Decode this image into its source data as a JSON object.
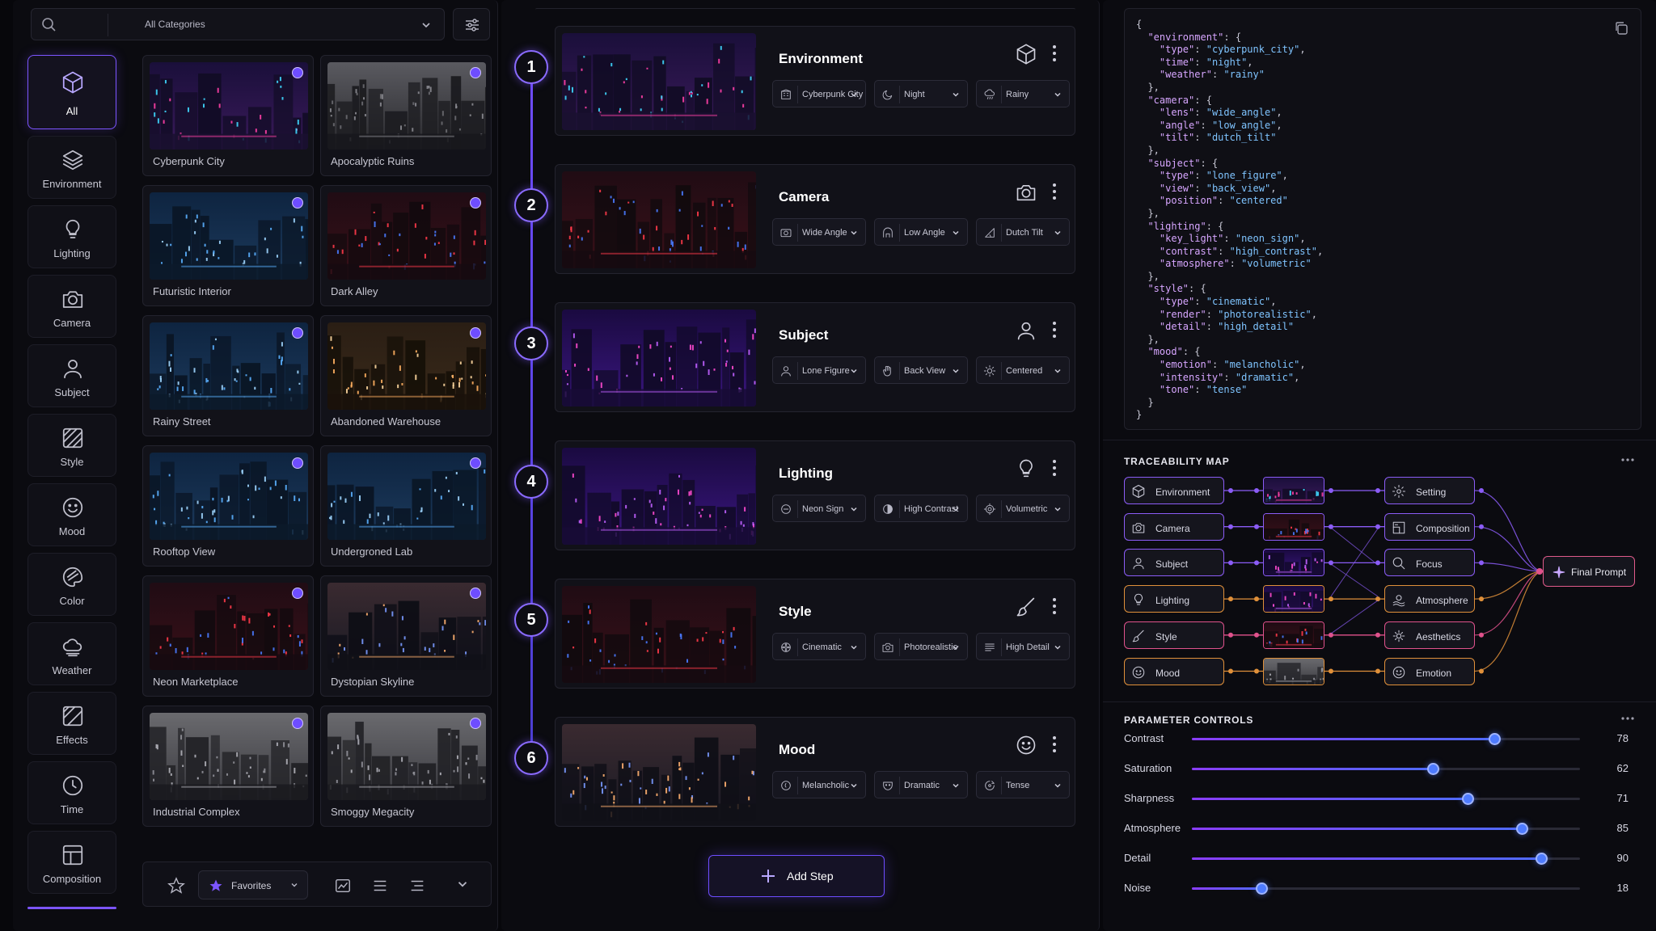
{
  "left": {
    "search_icon": "search-icon",
    "category_select": "All Categories",
    "categories": [
      {
        "label": "All",
        "icon": "cube-icon"
      },
      {
        "label": "Environment",
        "icon": "layers-icon"
      },
      {
        "label": "Lighting",
        "icon": "lightbulb-icon"
      },
      {
        "label": "Camera",
        "icon": "camera-icon"
      },
      {
        "label": "Subject",
        "icon": "person-icon"
      },
      {
        "label": "Style",
        "icon": "hatch-icon"
      },
      {
        "label": "Mood",
        "icon": "smiley-icon"
      },
      {
        "label": "Color",
        "icon": "palette-icon"
      },
      {
        "label": "Weather",
        "icon": "cloud-icon"
      },
      {
        "label": "Effects",
        "icon": "effects-icon"
      },
      {
        "label": "Time",
        "icon": "clock-icon"
      },
      {
        "label": "Composition",
        "icon": "layout-icon"
      }
    ],
    "presets": [
      "Cyberpunk City",
      "Apocalyptic Ruins",
      "Futuristic Interior",
      "Dark Alley",
      "Rainy Street",
      "Abandoned Warehouse",
      "Rooftop View",
      "Undergroned Lab",
      "Neon Marketplace",
      "Dystopian Skyline",
      "Industrial Complex",
      "Smoggy Megacity"
    ],
    "favorites_label": "Favorites"
  },
  "steps": [
    {
      "num": "1",
      "title": "Environment",
      "icon": "cube-icon",
      "pills": [
        "Cyberpunk City",
        "Night",
        "Rainy"
      ]
    },
    {
      "num": "2",
      "title": "Camera",
      "icon": "camera-icon",
      "pills": [
        "Wide Angle",
        "Low Angle",
        "Dutch Tilt"
      ]
    },
    {
      "num": "3",
      "title": "Subject",
      "icon": "person-icon",
      "pills": [
        "Lone Figure",
        "Back View",
        "Centered"
      ]
    },
    {
      "num": "4",
      "title": "Lighting",
      "icon": "lightbulb-icon",
      "pills": [
        "Neon Sign",
        "High Contrast",
        "Volumetric"
      ]
    },
    {
      "num": "5",
      "title": "Style",
      "icon": "brush-icon",
      "pills": [
        "Cinematic",
        "Photorealistic",
        "High Detail"
      ]
    },
    {
      "num": "6",
      "title": "Mood",
      "icon": "smiley-icon",
      "pills": [
        "Melancholic",
        "Dramatic",
        "Tense"
      ]
    }
  ],
  "add_step_label": "Add Step",
  "json_preview": [
    "{",
    "  \"environment\": {",
    "    \"type\": \"cyberpunk_city\",",
    "    \"time\": \"night\",",
    "    \"weather\": \"rainy\"",
    "  },",
    "  \"camera\": {",
    "    \"lens\": \"wide_angle\",",
    "    \"angle\": \"low_angle\",",
    "    \"tilt\": \"dutch_tilt\"",
    "  },",
    "  \"subject\": {",
    "    \"type\": \"lone_figure\",",
    "    \"view\": \"back_view\",",
    "    \"position\": \"centered\"",
    "  },",
    "  \"lighting\": {",
    "    \"key_light\": \"neon_sign\",",
    "    \"contrast\": \"high_contrast\",",
    "    \"atmosphere\": \"volumetric\"",
    "  },",
    "  \"style\": {",
    "    \"type\": \"cinematic\",",
    "    \"render\": \"photorealistic\",",
    "    \"detail\": \"high_detail\"",
    "  },",
    "  \"mood\": {",
    "    \"emotion\": \"melancholic\",",
    "    \"intensity\": \"dramatic\",",
    "    \"tone\": \"tense\"",
    "  }",
    "}"
  ],
  "traceability": {
    "title": "TRACEABILITY MAP",
    "sources": [
      "Environment",
      "Camera",
      "Subject",
      "Lighting",
      "Style",
      "Mood"
    ],
    "targets": [
      "Setting",
      "Composition",
      "Focus",
      "Atmosphere",
      "Aesthetics",
      "Emotion"
    ],
    "final": "Final Prompt",
    "colors": {
      "purple": "#8b5cf6",
      "pink": "#e0528c",
      "orange": "#e0903a"
    }
  },
  "parameters": {
    "title": "PARAMETER CONTROLS",
    "items": [
      {
        "label": "Contrast",
        "value": 78
      },
      {
        "label": "Saturation",
        "value": 62
      },
      {
        "label": "Sharpness",
        "value": 71
      },
      {
        "label": "Atmosphere",
        "value": 85
      },
      {
        "label": "Detail",
        "value": 90
      },
      {
        "label": "Noise",
        "value": 18
      }
    ]
  },
  "accent": "#7c55ff"
}
